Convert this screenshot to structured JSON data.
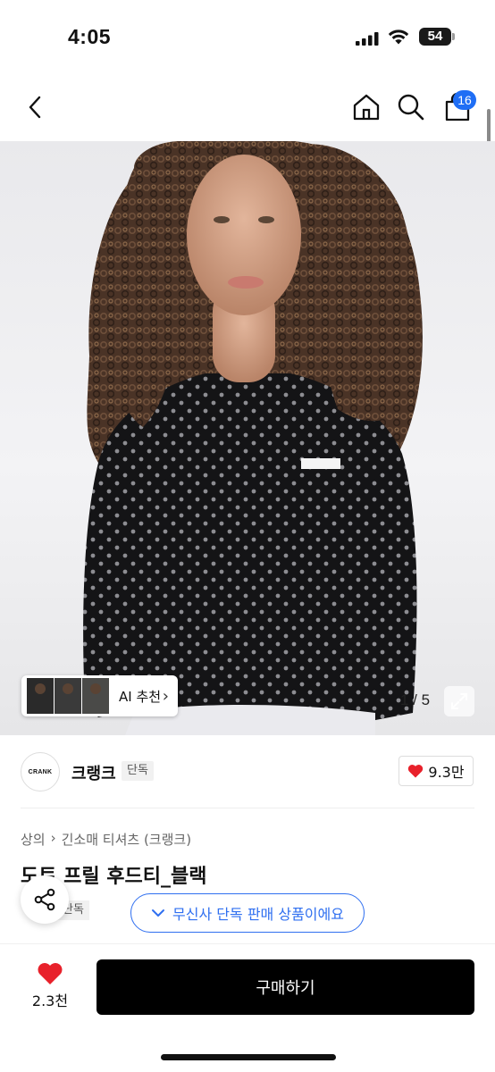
{
  "status_bar": {
    "time": "4:05",
    "battery": "54"
  },
  "header": {
    "cart_count": "16"
  },
  "gallery": {
    "ai_label": "AI 추천",
    "counter": "1 / 5",
    "current_page": 1,
    "total_pages": 5
  },
  "brand": {
    "logo_text": "CRANK",
    "name": "크랭크",
    "tag": "단독",
    "likes": "9.3만"
  },
  "breadcrumb": [
    "상의",
    "긴소매 티셔츠 (크랭크)"
  ],
  "product": {
    "title": "도트 프릴 후드티_블랙",
    "exclusive_tag": "단독",
    "exclusive_notice": "무신사 단독 판매 상품이에요"
  },
  "bottom_bar": {
    "wish_count": "2.3천",
    "buy_label": "구매하기"
  },
  "colors": {
    "accent": "#2f6ff0",
    "badge": "#1f6ef5",
    "heart": "#e8212b",
    "buy_button": "#000000"
  }
}
